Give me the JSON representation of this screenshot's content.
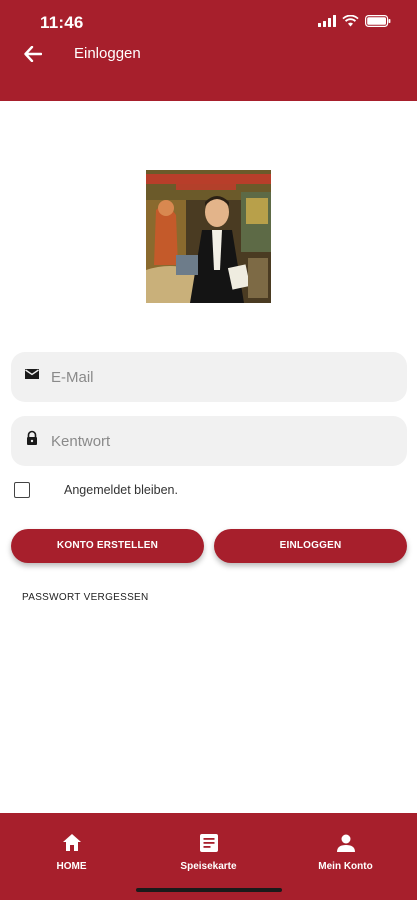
{
  "status_bar": {
    "time": "11:46"
  },
  "toolbar": {
    "title": "Einloggen",
    "back_icon": "arrow-left-icon"
  },
  "logo": {
    "alt": "Restaurant logo illustration"
  },
  "form": {
    "email": {
      "placeholder": "E-Mail",
      "value": "",
      "icon": "envelope-icon"
    },
    "password": {
      "placeholder": "Kentwort",
      "value": "",
      "icon": "lock-icon"
    },
    "remember_label": "Angemeldet bleiben.",
    "remember_checked": false
  },
  "buttons": {
    "create_account": "KONTO ERSTELLEN",
    "login": "EINLOGGEN",
    "forgot_password": "PASSWORT VERGESSEN"
  },
  "bottom_nav": {
    "items": [
      {
        "label": "HOME",
        "icon": "home-icon"
      },
      {
        "label": "Speisekarte",
        "icon": "menu-card-icon"
      },
      {
        "label": "Mein Konto",
        "icon": "person-icon"
      }
    ]
  },
  "colors": {
    "primary": "#a71f2c",
    "field_bg": "#f1f1f1",
    "text": "#222222"
  }
}
